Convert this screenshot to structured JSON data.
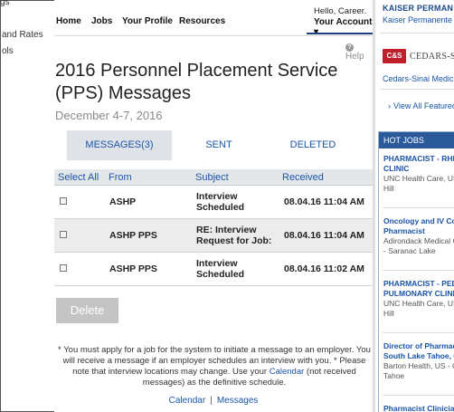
{
  "left_sidebar": {
    "items": [
      "gs",
      "and Rates",
      "ols"
    ]
  },
  "topnav": {
    "links": [
      "Home",
      "Jobs",
      "Your Profile",
      "Resources"
    ],
    "greeting": "Hello, Career.",
    "account": "Your Account ▾"
  },
  "help": {
    "label": "Help",
    "icon": "?"
  },
  "page": {
    "title": "2016 Personnel Placement Service (PPS) Messages",
    "date": "December 4-7, 2016"
  },
  "tabs": [
    {
      "label": "MESSAGES(3)",
      "active": true
    },
    {
      "label": "SENT",
      "active": false
    },
    {
      "label": "DELETED",
      "active": false
    }
  ],
  "table": {
    "headers": {
      "select_all": "Select All",
      "from": "From",
      "subject": "Subject",
      "received": "Received"
    },
    "rows": [
      {
        "from": "ASHP",
        "subject": "Interview Scheduled",
        "received": "08.04.16 11:04 AM"
      },
      {
        "from": "ASHP PPS",
        "subject": "RE: Interview Request for Job:",
        "received": "08.04.16 11:04 AM"
      },
      {
        "from": "ASHP PPS",
        "subject": "Interview Scheduled",
        "received": "08.04.16 11:02 AM"
      }
    ]
  },
  "delete_button": "Delete",
  "note": {
    "before": "* You must apply for a job for the system to initiate a message to an employer. You will receive a message if an employer schedules an interview with you. * Please note that interview locations may change. Use your ",
    "link": "Calendar",
    "after": " (not received messages) as the definitive schedule."
  },
  "footer": {
    "calendar": "Calendar",
    "separator": "|",
    "messages": "Messages"
  },
  "right_sidebar": {
    "kp_logo": "KAISER PERMAN",
    "kp_name": "Kaiser Permanente",
    "cs_badge": "C&S",
    "cs_logo_text": "CEDARS-S",
    "cs_name": "Cedars-Sinai Medical C",
    "view_all": "View All Featured",
    "hot_jobs_title": "HOT JOBS",
    "jobs": [
      {
        "title_lines": [
          "PHARMACIST - RHEUM",
          "CLINIC"
        ],
        "org_lines": [
          "UNC Health Care, US -",
          "Hill"
        ]
      },
      {
        "title_lines": [
          "Oncology and IV Com",
          "Pharmacist"
        ],
        "org_lines": [
          "Adirondack Medical Ce",
          "- Saranac Lake"
        ]
      },
      {
        "title_lines": [
          "PHARMACIST - PEDIA",
          "PULMONARY CLINIC"
        ],
        "org_lines": [
          "UNC Health Care, US -",
          "Hill"
        ]
      },
      {
        "title_lines": [
          "Director of Pharmacy",
          "South Lake Tahoe, Ca"
        ],
        "org_lines": [
          "Barton Health, US - CA",
          "Tahoe"
        ]
      },
      {
        "title_lines": [
          "Pharmacist Clinician"
        ],
        "org_lines": []
      }
    ]
  },
  "colors": {
    "link_blue": "#1a55a8",
    "hot_jobs_header": "#2a5a9a",
    "tab_active_bg": "#dfe3e8",
    "delete_bg": "#c4c4c4",
    "cs_red": "#c0202b"
  }
}
